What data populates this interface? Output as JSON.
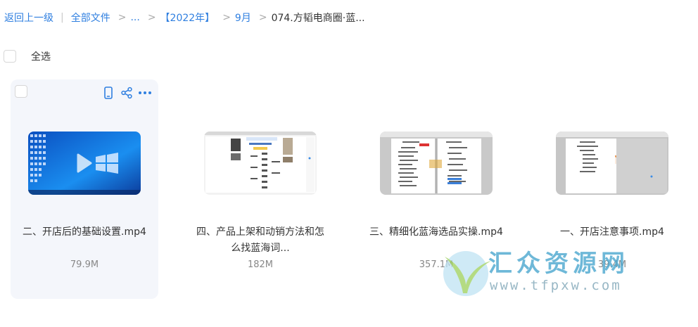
{
  "breadcrumb": {
    "back": "返回上一级",
    "root": "全部文件",
    "ellipsis": "...",
    "year": "【2022年】",
    "month": "9月",
    "current": "074.方韬电商圈·蓝..."
  },
  "select_all_label": "全选",
  "files": [
    {
      "name": "二、开店后的基础设置.mp4",
      "size": "79.9M"
    },
    {
      "name": "四、产品上架和动销方法和怎么找蓝海词...",
      "size": "182M"
    },
    {
      "name": "三、精细化蓝海选品实操.mp4",
      "size": "357.1M"
    },
    {
      "name": "一、开店注意事项.mp4",
      "size": "39.4M"
    }
  ],
  "watermark": {
    "title": "汇众资源网",
    "url": "www.tfpxw.com"
  },
  "colors": {
    "link": "#2f7fe0",
    "card_hover": "#f4f6fb",
    "size_text": "#888888"
  },
  "icons": [
    "phone-icon",
    "share-icon",
    "more-icon",
    "play-icon"
  ]
}
